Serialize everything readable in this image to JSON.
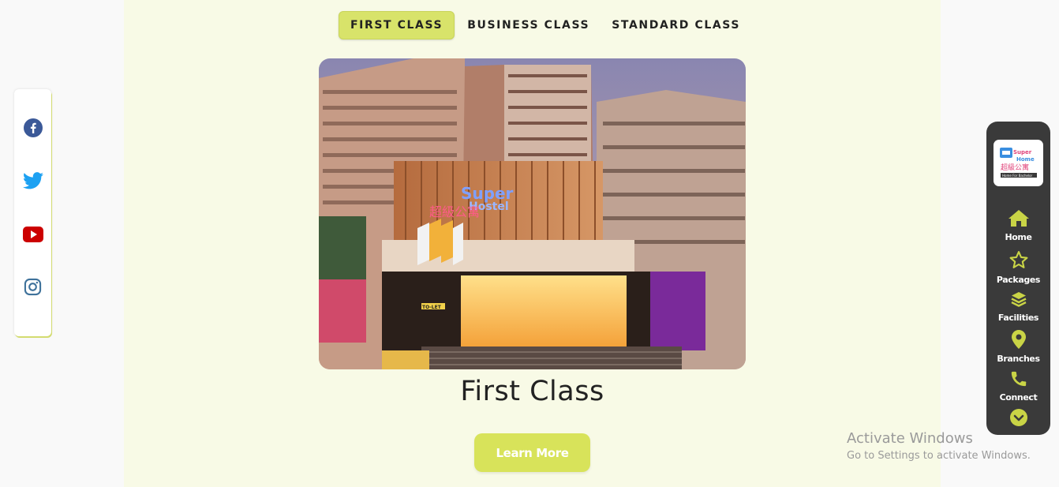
{
  "tabs": [
    {
      "label": "FIRST CLASS",
      "active": true
    },
    {
      "label": "BUSINESS CLASS",
      "active": false
    },
    {
      "label": "STANDARD CLASS",
      "active": false
    }
  ],
  "hero": {
    "sign_line1": "Super",
    "sign_line2": "Hostel",
    "sign_cjk": "超級公寓",
    "to_let": "TO-LET"
  },
  "title": "First Class",
  "learn_more_label": "Learn More",
  "social": [
    "facebook-icon",
    "twitter-icon",
    "youtube-icon",
    "instagram-icon"
  ],
  "logo": {
    "line1": "Super",
    "line2": "Home",
    "cjk": "超級公寓",
    "tag": "Home For Bachelor"
  },
  "nav": [
    {
      "label": "Home",
      "icon": "home-icon"
    },
    {
      "label": "Packages",
      "icon": "star-icon"
    },
    {
      "label": "Facilities",
      "icon": "layers-icon"
    },
    {
      "label": "Branches",
      "icon": "map-pin-icon"
    },
    {
      "label": "Connect",
      "icon": "phone-icon"
    }
  ],
  "watermark": {
    "line1": "Activate Windows",
    "line2": "Go to Settings to activate Windows."
  },
  "colors": {
    "accent": "#d8e35a",
    "panel": "#f8fae6",
    "nav_bg": "#3a3a3a",
    "facebook": "#3b5998",
    "twitter": "#1da1f2",
    "youtube": "#cc0000",
    "instagram": "#3f729b"
  }
}
